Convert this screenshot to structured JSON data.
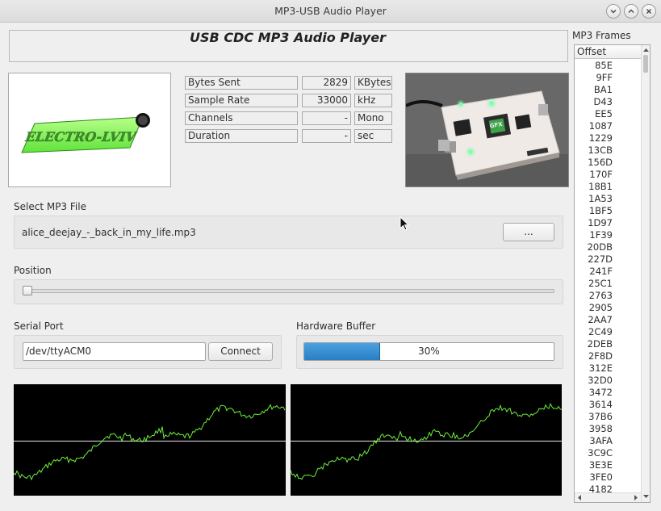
{
  "window": {
    "title": "MP3-USB Audio Player",
    "buttons": [
      "minimize",
      "maximize",
      "close"
    ]
  },
  "header": {
    "title": "USB CDC MP3 Audio Player"
  },
  "logo": {
    "text": "ELECTRO-LVIV"
  },
  "stats": [
    {
      "label": "Bytes Sent",
      "value": "2829",
      "unit": "KBytes"
    },
    {
      "label": "Sample Rate",
      "value": "33000",
      "unit": "kHz"
    },
    {
      "label": "Channels",
      "value": "-",
      "unit": "Mono"
    },
    {
      "label": "Duration",
      "value": "-",
      "unit": "sec"
    }
  ],
  "photo": {
    "chip_label": "GFX"
  },
  "select_file": {
    "label": "Select MP3 File",
    "filename": "alice_deejay_-_back_in_my_life.mp3",
    "browse_label": "..."
  },
  "position": {
    "label": "Position",
    "value": 0
  },
  "serial": {
    "label": "Serial Port",
    "port": "/dev/ttyACM0",
    "connect_label": "Connect"
  },
  "buffer": {
    "label": "Hardware Buffer",
    "percent": 30,
    "text": "30%"
  },
  "frames": {
    "title": "MP3 Frames",
    "column": "Offset",
    "items": [
      "85E",
      "9FF",
      "BA1",
      "D43",
      "EE5",
      "1087",
      "1229",
      "13CB",
      "156D",
      "170F",
      "18B1",
      "1A53",
      "1BF5",
      "1D97",
      "1F39",
      "20DB",
      "227D",
      "241F",
      "25C1",
      "2763",
      "2905",
      "2AA7",
      "2C49",
      "2DEB",
      "2F8D",
      "312E",
      "32D0",
      "3472",
      "3614",
      "37B6",
      "3958",
      "3AFA",
      "3C9C",
      "3E3E",
      "3FE0",
      "4182"
    ]
  },
  "colors": {
    "accent": "#2a7fc4",
    "waveform": "#6cf03a",
    "scope_bg": "#000000"
  }
}
